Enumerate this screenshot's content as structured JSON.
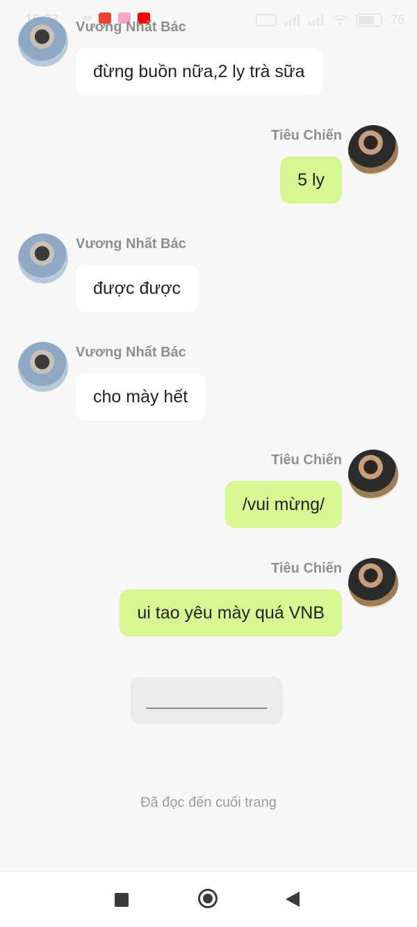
{
  "status_bar": {
    "time": "16:23",
    "battery": "76"
  },
  "messages": [
    {
      "side": "left",
      "sender": "Vương Nhất Bác",
      "text": "đừng buồn nữa,2 ly trà sữa"
    },
    {
      "side": "right",
      "sender": "Tiêu Chiến",
      "text": "5 ly"
    },
    {
      "side": "left",
      "sender": "Vương Nhất Bác",
      "text": "được được"
    },
    {
      "side": "left",
      "sender": "Vương Nhất Bác",
      "text": "cho mày hết"
    },
    {
      "side": "right",
      "sender": "Tiêu Chiến",
      "text": "/vui mừng/"
    },
    {
      "side": "right",
      "sender": "Tiêu Chiến",
      "text": "ui tao yêu mày quá VNB"
    }
  ],
  "divider_text": "_____________",
  "end_note": "Đã đọc đến cuối trang",
  "colors": {
    "background": "#f7f7f7",
    "incoming_bubble": "#ffffff",
    "outgoing_bubble": "#d7f694",
    "sender_name": "#8e8e8e"
  },
  "icons": {
    "status_apps": [
      "more-dots-icon",
      "gmail-icon",
      "game-app-icon",
      "youtube-icon"
    ],
    "status_right": [
      "hd-icon",
      "signal-icon",
      "signal-icon",
      "wifi-icon",
      "battery-icon"
    ],
    "nav": [
      "recents-square-icon",
      "home-circle-icon",
      "back-triangle-icon"
    ]
  }
}
